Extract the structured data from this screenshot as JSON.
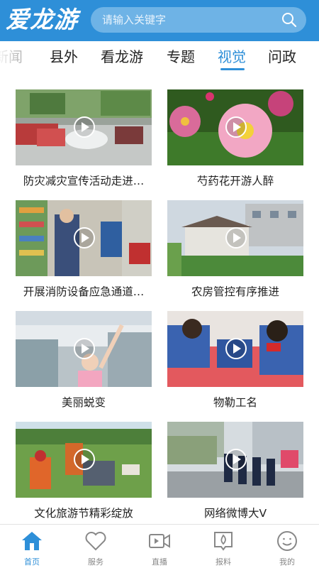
{
  "header": {
    "logo_text": "爱龙游",
    "search_placeholder": "请输入关键字"
  },
  "tabs": [
    {
      "label": "新闻"
    },
    {
      "label": "县外"
    },
    {
      "label": "看龙游"
    },
    {
      "label": "专题"
    },
    {
      "label": "视觉",
      "active": true
    },
    {
      "label": "问政"
    }
  ],
  "videos": [
    {
      "title": "防灾减灾宣传活动走进…"
    },
    {
      "title": "芍药花开游人醉"
    },
    {
      "title": "开展消防设备应急通道…"
    },
    {
      "title": "农房管控有序推进"
    },
    {
      "title": "美丽蜕变"
    },
    {
      "title": "物勒工名"
    },
    {
      "title": "文化旅游节精彩绽放"
    },
    {
      "title": "网络微博大V"
    }
  ],
  "bottom_nav": [
    {
      "label": "首页",
      "icon": "home-icon",
      "active": true
    },
    {
      "label": "服务",
      "icon": "heart-icon"
    },
    {
      "label": "直播",
      "icon": "video-camera-icon"
    },
    {
      "label": "报料",
      "icon": "fire-report-icon"
    },
    {
      "label": "我的",
      "icon": "smiley-user-icon"
    }
  ],
  "colors": {
    "brand": "#2e8fd8",
    "nav_inactive": "#888888"
  }
}
